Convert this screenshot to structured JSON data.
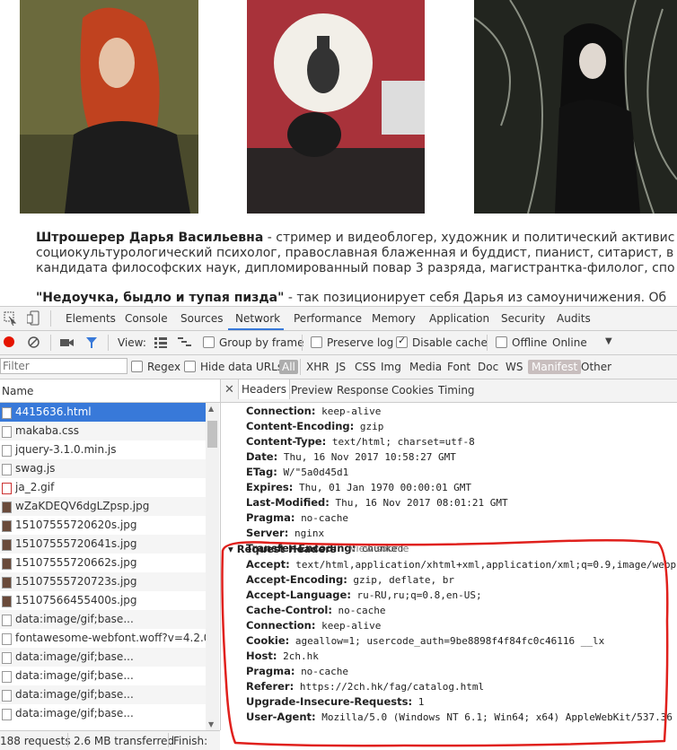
{
  "article": {
    "p1_bold": "Штрошерер Дарья Васильевна",
    "p1_rest": " - стример и видеоблогер, художник и политический активис",
    "p1_line2": "социокультурологический психолог, православная блаженная и буддист, пианист, ситарист, в",
    "p1_line3": "кандидата философских наук, дипломированный повар 3 разряда, магистрантка-филолог, спо",
    "p2_bold": "\"Недоучка, быдло и тупая пизда\"",
    "p2_rest": " - так позиционирует себя Дарья из самоуничижения. Об"
  },
  "devtools": {
    "tabs": [
      "Elements",
      "Console",
      "Sources",
      "Network",
      "Performance",
      "Memory",
      "Application",
      "Security",
      "Audits"
    ],
    "toolbar": {
      "view_label": "View:",
      "group_by_frame": "Group by frame",
      "preserve_log": "Preserve log",
      "disable_cache": "Disable cache",
      "offline": "Offline",
      "online": "Online"
    },
    "filter": {
      "placeholder": "Filter",
      "regex": "Regex",
      "hide_data_urls": "Hide data URLs",
      "types": [
        "All",
        "XHR",
        "JS",
        "CSS",
        "Img",
        "Media",
        "Font",
        "Doc",
        "WS",
        "Manifest",
        "Other"
      ]
    },
    "list": {
      "header": "Name",
      "rows": [
        "4415636.html",
        "makaba.css",
        "jquery-3.1.0.min.js",
        "swag.js",
        "ja_2.gif",
        "wZaKDEQV6dgLZpsp.jpg",
        "15107555720620s.jpg",
        "15107555720641s.jpg",
        "15107555720662s.jpg",
        "15107555720723s.jpg",
        "15107566455400s.jpg",
        "data:image/gif;base...",
        "fontawesome-webfont.woff?v=4.2.0",
        "data:image/gif;base...",
        "data:image/gif;base...",
        "data:image/gif;base...",
        "data:image/gif;base..."
      ]
    },
    "status": {
      "requests": "188 requests",
      "transferred": "2.6 MB transferred",
      "finish": "Finish: "
    },
    "panel_tabs": [
      "Headers",
      "Preview",
      "Response",
      "Cookies",
      "Timing"
    ],
    "response_headers": [
      {
        "k": "Connection:",
        "v": "keep-alive"
      },
      {
        "k": "Content-Encoding:",
        "v": "gzip"
      },
      {
        "k": "Content-Type:",
        "v": "text/html; charset=utf-8"
      },
      {
        "k": "Date:",
        "v": "Thu, 16 Nov 2017 10:58:27 GMT"
      },
      {
        "k": "ETag:",
        "v": "W/\"5a0d45d1"
      },
      {
        "k": "Expires:",
        "v": "Thu, 01 Jan 1970 00:00:01 GMT"
      },
      {
        "k": "Last-Modified:",
        "v": "Thu, 16 Nov 2017 08:01:21 GMT"
      },
      {
        "k": "Pragma:",
        "v": "no-cache"
      },
      {
        "k": "Server:",
        "v": "nginx"
      },
      {
        "k": "Transfer-Encoding:",
        "v": "chunked"
      }
    ],
    "request_headers_title": "Request Headers",
    "view_source": "view source",
    "request_headers": [
      {
        "k": "Accept:",
        "v": "text/html,application/xhtml+xml,application/xml;q=0.9,image/webp,i"
      },
      {
        "k": "Accept-Encoding:",
        "v": "gzip, deflate, br"
      },
      {
        "k": "Accept-Language:",
        "v": "ru-RU,ru;q=0.8,en-US;"
      },
      {
        "k": "Cache-Control:",
        "v": "no-cache"
      },
      {
        "k": "Connection:",
        "v": "keep-alive"
      },
      {
        "k": "Cookie:",
        "v": "ageallow=1; usercode_auth=9be8898f4f84fc0c46116              __lx"
      },
      {
        "k": "Host:",
        "v": "2ch.hk"
      },
      {
        "k": "Pragma:",
        "v": "no-cache"
      },
      {
        "k": "Referer:",
        "v": "https://2ch.hk/fag/catalog.html"
      },
      {
        "k": "Upgrade-Insecure-Requests:",
        "v": "1"
      },
      {
        "k": "User-Agent:",
        "v": "Mozilla/5.0 (Windows NT 6.1; Win64; x64) AppleWebKit/537.36"
      }
    ],
    "colors": {
      "accent": "#3879d9",
      "record": "#e51400",
      "annotation": "#e0201c"
    }
  }
}
